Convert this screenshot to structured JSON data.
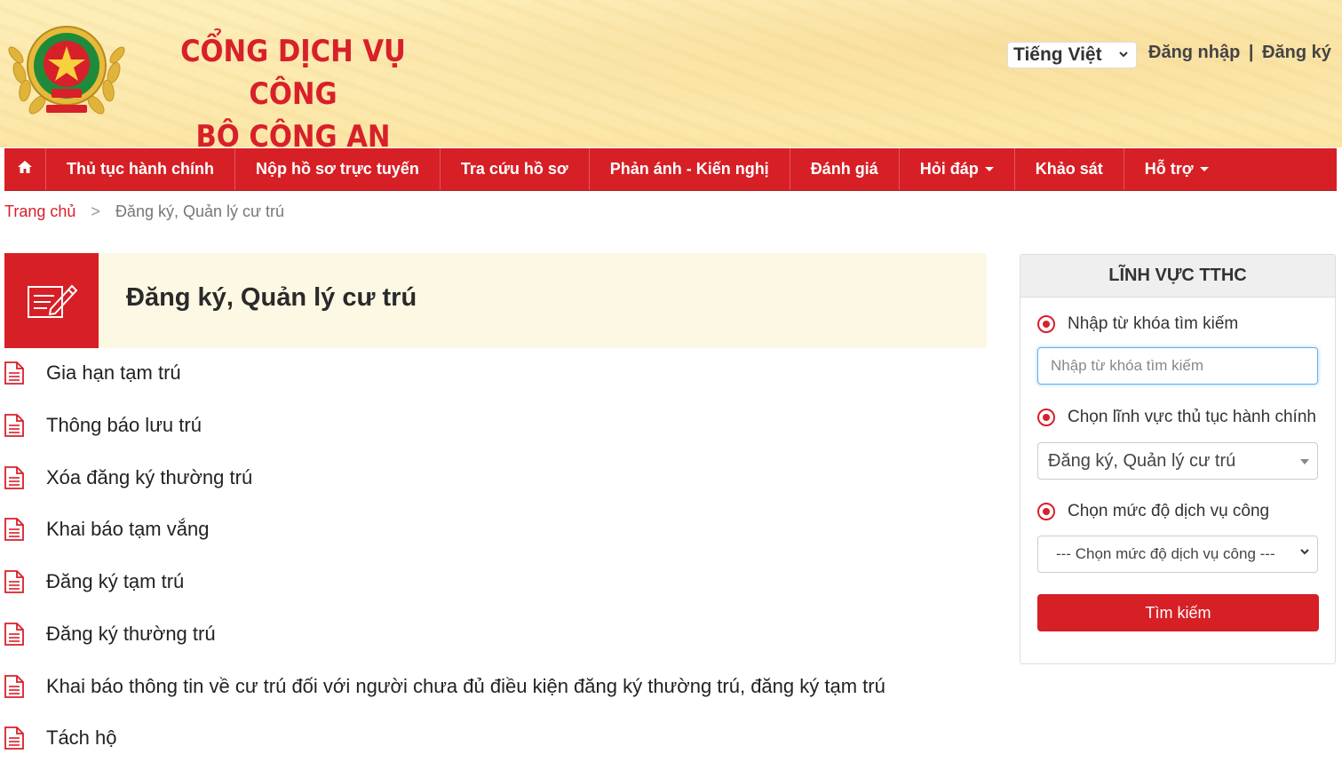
{
  "header": {
    "title_line1": "CỔNG DỊCH VỤ CÔNG",
    "title_line2": "BỘ CÔNG AN",
    "language": "Tiếng Việt",
    "login": "Đăng nhập",
    "separator": "|",
    "register": "Đăng ký",
    "colors": {
      "brand_red": "#d71f26",
      "header_bg": "#fbe6a6"
    }
  },
  "nav": {
    "home_icon": "home-icon",
    "items": [
      {
        "label": "Thủ tục hành chính"
      },
      {
        "label": "Nộp hồ sơ trực tuyến"
      },
      {
        "label": "Tra cứu hồ sơ"
      },
      {
        "label": "Phản ánh - Kiến nghị"
      },
      {
        "label": "Đánh giá"
      },
      {
        "label": "Hỏi đáp"
      },
      {
        "label": "Khảo sát"
      },
      {
        "label": "Hỗ trợ"
      }
    ]
  },
  "breadcrumb": {
    "home": "Trang chủ",
    "separator": ">",
    "current": "Đăng ký, Quản lý cư trú"
  },
  "main": {
    "title": "Đăng ký, Quản lý cư trú",
    "procedures": [
      "Gia hạn tạm trú",
      "Thông báo lưu trú",
      "Xóa đăng ký thường trú",
      "Khai báo tạm vắng",
      "Đăng ký tạm trú",
      "Đăng ký thường trú",
      "Khai báo thông tin về cư trú đối với người chưa đủ điều kiện đăng ký thường trú, đăng ký tạm trú",
      "Tách hộ"
    ]
  },
  "sidebar": {
    "heading": "LĨNH VỰC TTHC",
    "keyword_radio": "Nhập từ khóa tìm kiếm",
    "keyword_placeholder": "Nhập từ khóa tìm kiếm",
    "field_radio": "Chọn lĩnh vực thủ tục hành chính",
    "field_value": "Đăng ký, Quản lý cư trú",
    "level_radio": "Chọn mức độ dịch vụ công",
    "level_value": "--- Chọn mức độ dịch vụ công ---",
    "search_button": "Tìm kiếm"
  }
}
